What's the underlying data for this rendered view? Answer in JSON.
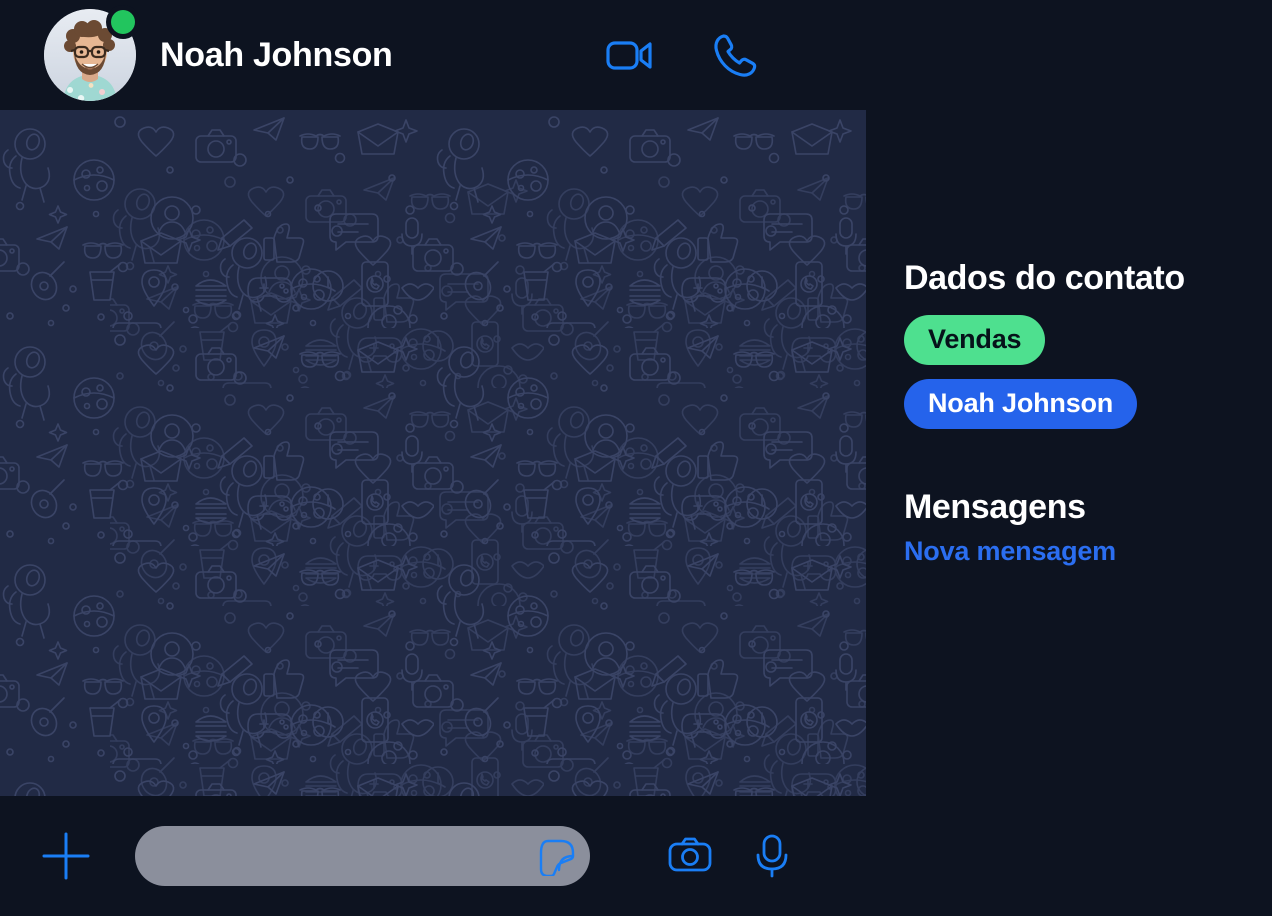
{
  "theme": {
    "page_bg": "#0d1320",
    "wallpaper_bg": "#212a45",
    "wallpaper_doodle": "#3a4466",
    "accent_blue": "#2b6ef0",
    "icon_blue": "#1a7ef5",
    "tag_green": "#4ee08f",
    "tag_blue": "#2563eb",
    "presence_green": "#22c55e",
    "input_bg": "#8b8f9c",
    "text_primary": "#ffffff"
  },
  "header": {
    "contact_name": "Noah Johnson",
    "presence": "online",
    "avatar_alt": "Noah Johnson",
    "video_call_icon": "video-camera-icon",
    "voice_call_icon": "phone-icon"
  },
  "side_panel": {
    "contact_section_title": "Dados do contato",
    "tags": [
      {
        "label": "Vendas",
        "style": "green"
      },
      {
        "label": "Noah Johnson",
        "style": "blue"
      }
    ],
    "messages_section_title": "Mensagens",
    "new_message_link": "Nova mensagem"
  },
  "composer": {
    "attach_icon": "plus-icon",
    "input_value": "",
    "input_placeholder": "",
    "sticker_icon": "sticker-icon",
    "camera_icon": "camera-icon",
    "mic_icon": "microphone-icon"
  }
}
